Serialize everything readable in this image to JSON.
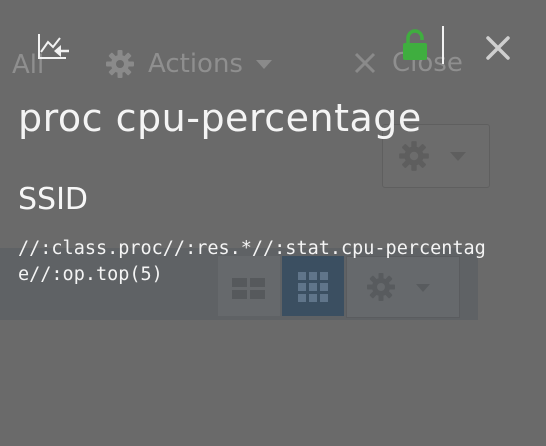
{
  "background": {
    "toolbar": {
      "all_label": "All",
      "actions_label": "Actions",
      "close_label": "Close"
    }
  },
  "popup": {
    "title": "proc cpu-percentage",
    "section_label": "SSID",
    "query": "//:class.proc//:res.*//:stat.cpu-percentage//:op.top(5)",
    "icons": {
      "chart_back": "chart-back-icon",
      "lock": "lock-icon",
      "close": "close-icon"
    },
    "lock_color": "#3fae3f"
  }
}
